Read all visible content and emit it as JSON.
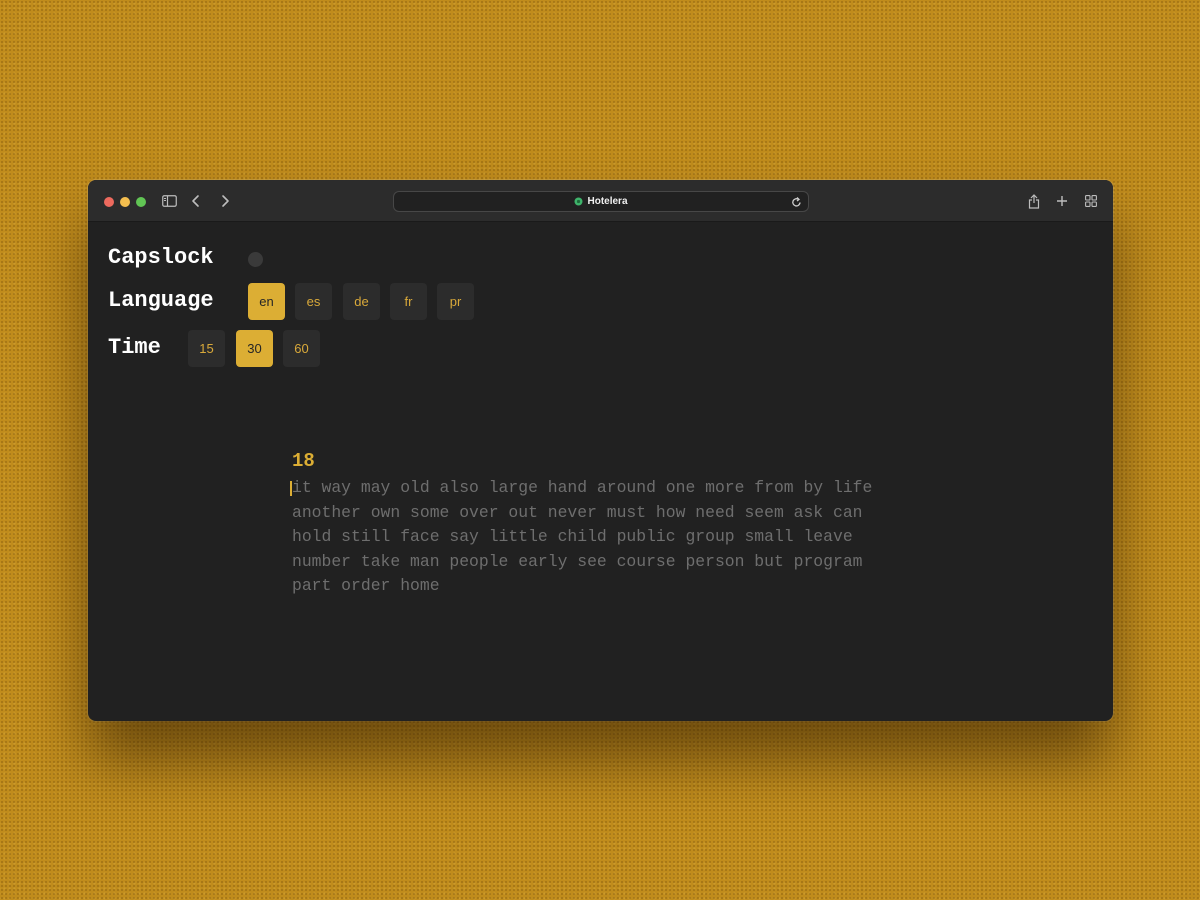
{
  "browser": {
    "url_title": "Hotelera",
    "icons": [
      "sidebar-icon",
      "back-icon",
      "forward-icon",
      "site-icon",
      "reload-icon",
      "share-icon",
      "new-tab-icon",
      "tab-overview-icon"
    ]
  },
  "settings": {
    "capslock_label": "Capslock",
    "language_label": "Language",
    "time_label": "Time",
    "languages": [
      "en",
      "es",
      "de",
      "fr",
      "pr"
    ],
    "selected_language": "en",
    "times": [
      "15",
      "30",
      "60"
    ],
    "selected_time": "30"
  },
  "test": {
    "timer": "18",
    "lines": [
      "it way may old also large hand around one more from by life",
      "another own some over out never must how need seem ask can",
      "hold still face say little child public group small leave",
      "number take man people early see course person but program",
      "part order home"
    ]
  },
  "colors": {
    "accent": "#dcae34",
    "window_bg": "#212121",
    "desktop_bg": "#c08c1c",
    "text_dim": "#6e6e6e"
  }
}
